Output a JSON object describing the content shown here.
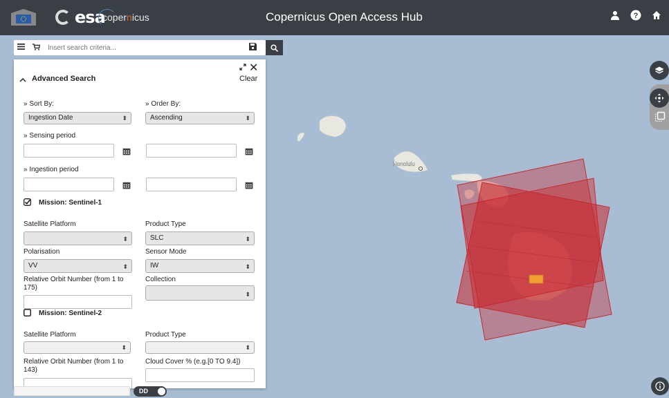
{
  "app": {
    "title": "Copernicus Open Access Hub",
    "esa_logo_text": "esa",
    "copernicus_logo_text_a": "oper",
    "copernicus_logo_text_b": "n",
    "copernicus_logo_text_c": "icus",
    "copernicus_logo_prefix": "c"
  },
  "header_icons": [
    "user-icon",
    "help-icon",
    "home-icon"
  ],
  "search": {
    "placeholder": "Insert search criteria..."
  },
  "advanced_search": {
    "title": "Advanced Search",
    "clear_label": "Clear",
    "sort_by_label": "» Sort By:",
    "sort_by_value": "Ingestion Date",
    "order_by_label": "» Order By:",
    "order_by_value": "Ascending",
    "sensing_period_label": "» Sensing period",
    "ingestion_period_label": "» Ingestion period"
  },
  "sentinel1": {
    "mission_label": "Mission: Sentinel-1",
    "checked": true,
    "satellite_platform_label": "Satellite Platform",
    "satellite_platform_value": "",
    "product_type_label": "Product Type",
    "product_type_value": "SLC",
    "polarisation_label": "Polarisation",
    "polarisation_value": "VV",
    "sensor_mode_label": "Sensor Mode",
    "sensor_mode_value": "IW",
    "relative_orbit_label_line1": "Relative Orbit Number (from 1 to",
    "relative_orbit_label_line2": "175)",
    "collection_label": "Collection",
    "collection_value": ""
  },
  "sentinel2": {
    "mission_label": "Mission: Sentinel-2",
    "checked": false,
    "satellite_platform_label": "Satellite Platform",
    "product_type_label": "Product Type",
    "relative_orbit_label_line1": "Relative Orbit Number (from 1 to",
    "relative_orbit_label_line2": "143)",
    "cloud_cover_label": "Cloud Cover % (e.g.[0 TO 9.4])"
  },
  "map": {
    "place_label": "Honolulu",
    "footprint_color": "#c8282d",
    "coord_format_toggle": "DD"
  },
  "colors": {
    "header_bg": "#3a3f46",
    "ocean": "#a8bdd3",
    "footprint": "#c8282d",
    "selection_marker": "#f0a030"
  }
}
